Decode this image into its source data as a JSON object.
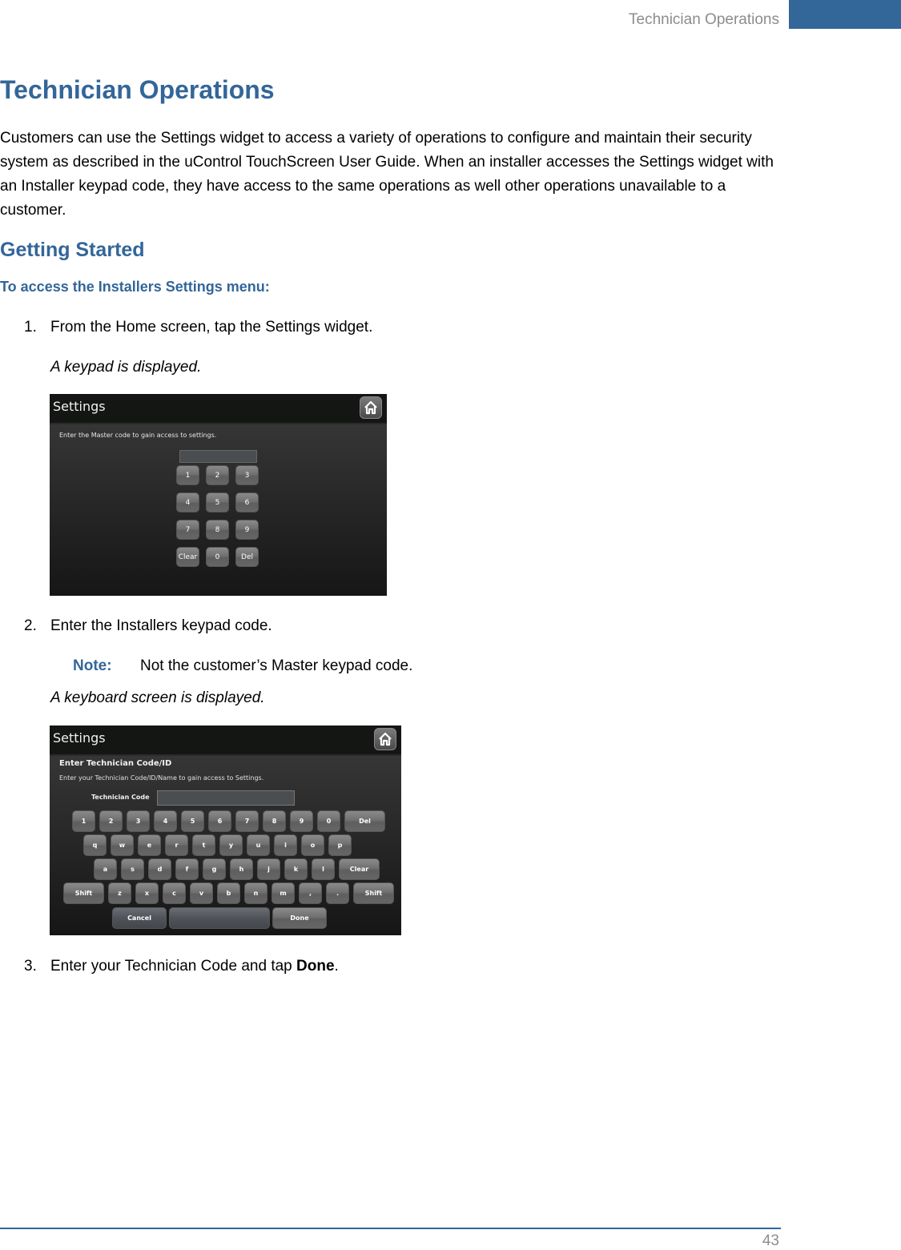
{
  "header": {
    "running_title": "Technician Operations",
    "accent_color": "#336699"
  },
  "title": "Technician Operations",
  "intro": "Customers can use the Settings widget to access a variety of operations to configure and maintain their security system as described in the uControl TouchScreen User Guide. When an installer accesses the Settings widget with an Installer keypad code, they have access to the same operations as well other operations unavailable to a customer.",
  "section": {
    "heading": "Getting Started",
    "procedure_heading": "To access the Installers Settings menu:",
    "steps": [
      {
        "num": "1.",
        "text": "From the Home screen, tap the Settings widget.",
        "result": "A keypad is displayed."
      },
      {
        "num": "2.",
        "text": "Enter the Installers keypad code.",
        "note_label": "Note:",
        "note_text": "Not the customer’s Master keypad code.",
        "result": "A keyboard screen is displayed."
      },
      {
        "num": "3.",
        "text_before": "Enter your Technician Code and tap ",
        "text_bold": "Done",
        "text_after": "."
      }
    ]
  },
  "screen1": {
    "title": "Settings",
    "home_icon": "home-icon",
    "prompt": "Enter the Master code to gain access to settings.",
    "keys": [
      "1",
      "2",
      "3",
      "4",
      "5",
      "6",
      "7",
      "8",
      "9",
      "Clear",
      "0",
      "Del"
    ]
  },
  "screen2": {
    "title": "Settings",
    "home_icon": "home-icon",
    "subtitle": "Enter Technician Code/ID",
    "prompt": "Enter your Technician Code/ID/Name to gain access to Settings.",
    "field_label": "Technician Code",
    "field_value": "",
    "rows": [
      [
        "1",
        "2",
        "3",
        "4",
        "5",
        "6",
        "7",
        "8",
        "9",
        "0",
        "Del"
      ],
      [
        "q",
        "w",
        "e",
        "r",
        "t",
        "y",
        "u",
        "i",
        "o",
        "p"
      ],
      [
        "a",
        "s",
        "d",
        "f",
        "g",
        "h",
        "j",
        "k",
        "l",
        "Clear"
      ],
      [
        "Shift",
        "z",
        "x",
        "c",
        "v",
        "b",
        "n",
        "m",
        ",",
        ".",
        "Shift"
      ]
    ],
    "cancel_label": "Cancel",
    "space_label": "",
    "done_label": "Done"
  },
  "footer": {
    "page_number": "43"
  }
}
